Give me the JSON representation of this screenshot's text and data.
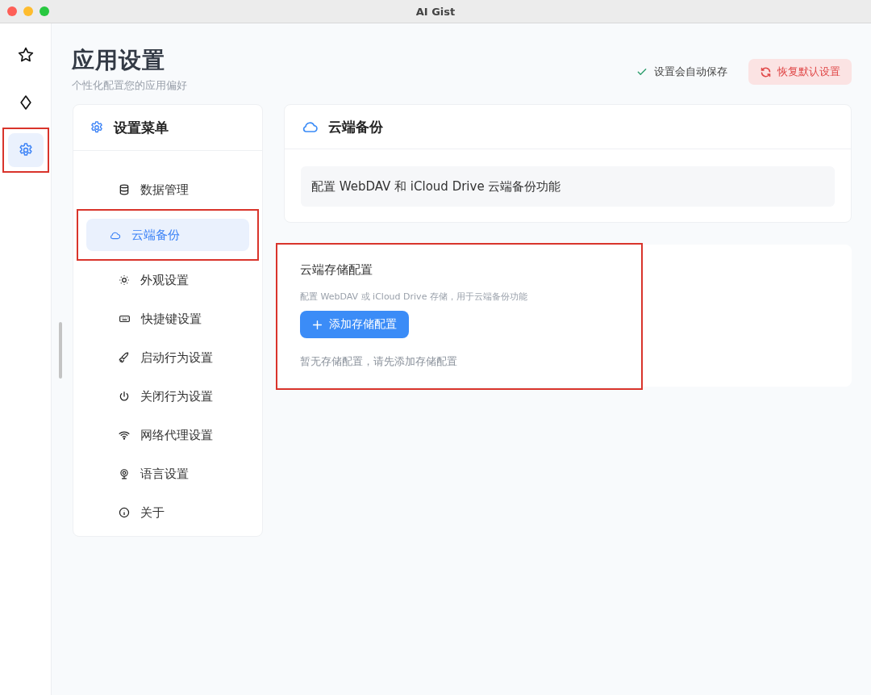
{
  "window": {
    "title": "AI Gist"
  },
  "rail": {
    "items": [
      {
        "selected": false,
        "annotated": false
      },
      {
        "selected": false,
        "annotated": false
      },
      {
        "selected": true,
        "annotated": true
      }
    ]
  },
  "header": {
    "title": "应用设置",
    "subtitle": "个性化配置您的应用偏好",
    "autosave": "设置会自动保存",
    "reset_button": "恢复默认设置"
  },
  "menu": {
    "title": "设置菜单",
    "items": [
      {
        "label": "数据管理",
        "selected": false,
        "annotated": false
      },
      {
        "label": "云端备份",
        "selected": true,
        "annotated": true
      },
      {
        "label": "外观设置",
        "selected": false,
        "annotated": false
      },
      {
        "label": "快捷键设置",
        "selected": false,
        "annotated": false
      },
      {
        "label": "启动行为设置",
        "selected": false,
        "annotated": false
      },
      {
        "label": "关闭行为设置",
        "selected": false,
        "annotated": false
      },
      {
        "label": "网络代理设置",
        "selected": false,
        "annotated": false
      },
      {
        "label": "语言设置",
        "selected": false,
        "annotated": false
      },
      {
        "label": "关于",
        "selected": false,
        "annotated": false
      }
    ]
  },
  "section": {
    "title": "云端备份",
    "description": "配置 WebDAV 和 iCloud Drive 云端备份功能"
  },
  "storage": {
    "title": "云端存储配置",
    "hint": "配置 WebDAV 或 iCloud Drive 存储，用于云端备份功能",
    "add_button": "添加存储配置",
    "empty_text": "暂无存储配置，请先添加存储配置",
    "annotated": true
  }
}
